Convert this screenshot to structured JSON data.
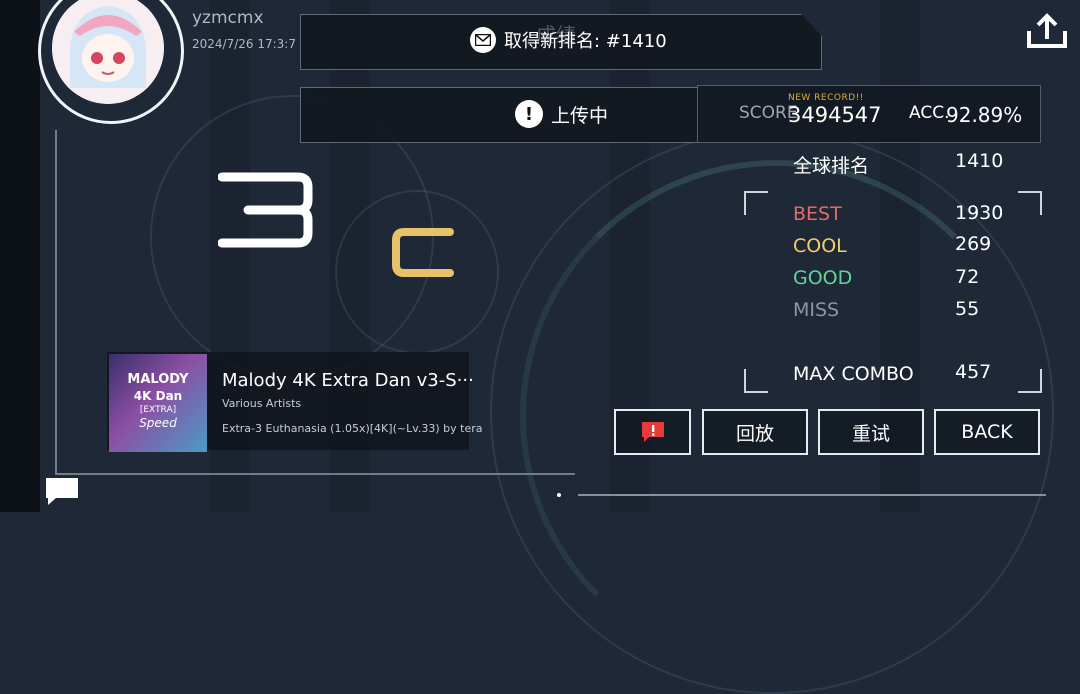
{
  "user": {
    "name": "yzmcmx",
    "date": "2024/7/26 17:3:7"
  },
  "notices": {
    "faint_title": "成绩",
    "rank_message": "取得新排名: #1410",
    "upload_status": "上传中"
  },
  "score": {
    "new_record": "NEW RECORD!!",
    "label": "SCORE",
    "value": "3494547",
    "acc_label": "ACC.",
    "acc_value": "92.89%"
  },
  "grade": {
    "rank_number": "3",
    "rank_letter": "C"
  },
  "stats": {
    "global_rank_label": "全球排名",
    "global_rank_value": "1410",
    "best_label": "BEST",
    "best_value": "1930",
    "cool_label": "COOL",
    "cool_value": "269",
    "good_label": "GOOD",
    "good_value": "72",
    "miss_label": "MISS",
    "miss_value": "55",
    "max_combo_label": "MAX COMBO",
    "max_combo_value": "457"
  },
  "song": {
    "cover_line1": "MALODY",
    "cover_line2": "4K Dan",
    "cover_line3": "[EXTRA]",
    "cover_line4": "Speed",
    "title": "Malody 4K Extra Dan v3-S···",
    "artist": "Various Artists",
    "difficulty": "Extra-3 Euthanasia (1.05x)[4K](~Lv.33) by tera"
  },
  "buttons": {
    "replay": "回放",
    "retry": "重试",
    "back": "BACK"
  },
  "icons": {
    "mail": "mail-icon",
    "alert": "alert-icon",
    "report": "report-icon",
    "upload": "upload-icon",
    "chat": "chat-icon"
  },
  "colors": {
    "best": "#e36a6a",
    "cool": "#f0cf6a",
    "good": "#61d49a",
    "miss": "#8d97a3",
    "grade_c": "#e8c26a",
    "report": "#e53b3b"
  }
}
